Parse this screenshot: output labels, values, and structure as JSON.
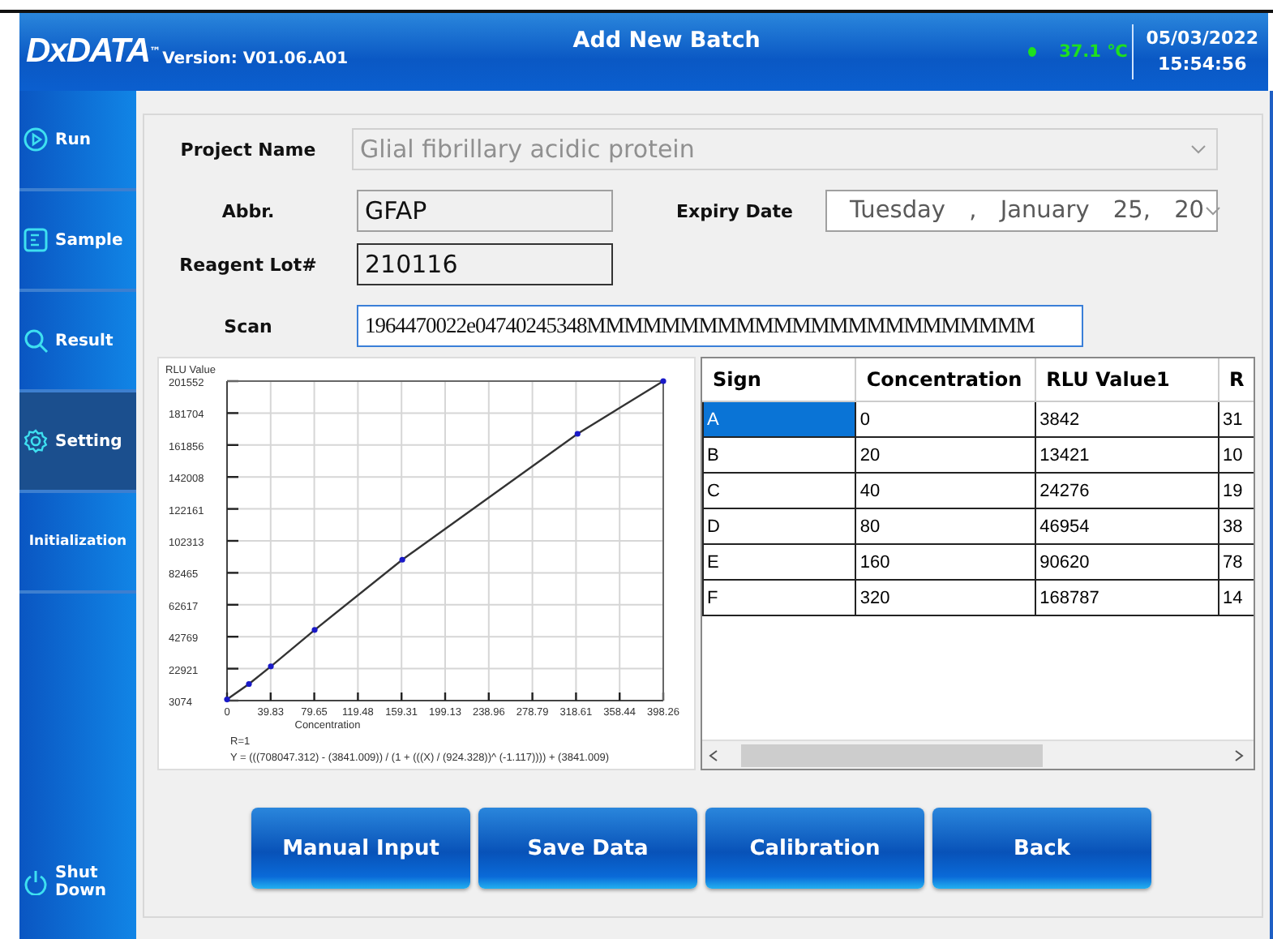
{
  "header": {
    "logo": "DxDATA",
    "logo_mark": "™",
    "version": "Version: V01.06.A01",
    "title": "Add New Batch",
    "temperature": "37.1 ℃",
    "date": "05/03/2022",
    "time": "15:54:56"
  },
  "sidebar": {
    "items": [
      {
        "label": "Run",
        "selected": false
      },
      {
        "label": "Sample",
        "selected": false
      },
      {
        "label": "Result",
        "selected": false
      },
      {
        "label": "Setting",
        "selected": true
      },
      {
        "label": "Initialization",
        "selected": false
      },
      {
        "label": "Shut Down",
        "selected": false
      }
    ]
  },
  "form": {
    "project_name": {
      "label": "Project Name",
      "value": "Glial fibrillary acidic protein",
      "disabled": true
    },
    "abbr": {
      "label": "Abbr.",
      "value": "GFAP"
    },
    "expiry_date": {
      "label": "Expiry Date",
      "value": "Tuesday , January 25, 20"
    },
    "reagent_lot": {
      "label": "Reagent Lot#",
      "value": "210116"
    },
    "scan": {
      "label": "Scan",
      "value": "1964470022e04740245348MMMMMMMMMMMMMMMMMMMMMMMM",
      "focused": true
    }
  },
  "chart_data": {
    "type": "line",
    "xlabel": "Concentration",
    "ylabel": "RLU Value",
    "x": [
      0,
      20,
      40,
      80,
      160,
      320,
      398.26
    ],
    "series": [
      {
        "color": "#333333",
        "marker": true,
        "values": [
          3800,
          13400,
          24300,
          47000,
          90600,
          168800,
          201552
        ]
      }
    ],
    "grid": true,
    "xlim": [
      0,
      398.26
    ],
    "ylim": [
      3074,
      201552
    ],
    "xticks": [
      0,
      39.83,
      79.65,
      119.48,
      159.31,
      199.13,
      238.96,
      278.79,
      318.61,
      358.44,
      398.26
    ],
    "yticks": [
      3074,
      22921,
      42769,
      62617,
      82465,
      102313,
      122161,
      142008,
      161856,
      181704,
      201552
    ],
    "annotations": [
      "R=1",
      "Y = (((708047.312) - (3841.009)) / (1 +  (((X) / (924.328))^ (-1.117)))) + (3841.009)"
    ]
  },
  "table": {
    "columns": [
      "Sign",
      "Concentration",
      "RLU Value1",
      "R"
    ],
    "rows": [
      {
        "cells": [
          "A",
          "0",
          "3842",
          "31"
        ],
        "selected": true
      },
      {
        "cells": [
          "B",
          "20",
          "13421",
          "10"
        ],
        "selected": false
      },
      {
        "cells": [
          "C",
          "40",
          "24276",
          "19"
        ],
        "selected": false
      },
      {
        "cells": [
          "D",
          "80",
          "46954",
          "38"
        ],
        "selected": false
      },
      {
        "cells": [
          "E",
          "160",
          "90620",
          "78"
        ],
        "selected": false
      },
      {
        "cells": [
          "F",
          "320",
          "168787",
          "14"
        ],
        "selected": false
      }
    ]
  },
  "buttons": [
    "Manual Input",
    "Save Data",
    "Calibration",
    "Back"
  ]
}
